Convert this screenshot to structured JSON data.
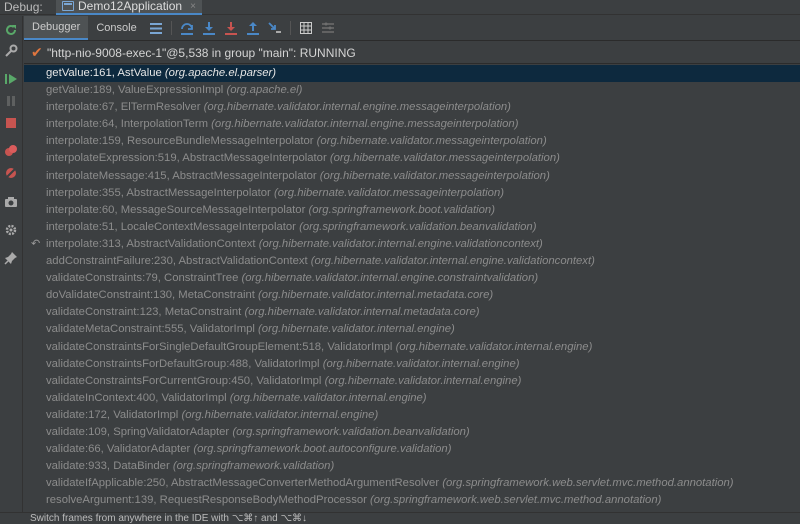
{
  "header": {
    "debug_label": "Debug:",
    "run_config": "Demo12Application",
    "close_glyph": "×"
  },
  "tabs": {
    "debugger": "Debugger",
    "console": "Console"
  },
  "toolbar_icons": [
    "list-icon",
    "step-over-icon",
    "step-into-icon",
    "force-step-into-icon",
    "step-out-icon",
    "run-to-cursor-icon",
    "evaluate-icon",
    "trace-icon"
  ],
  "left_toolbar_icons": [
    "rerun-icon",
    "settings-icon",
    "resume-icon",
    "pause-icon",
    "stop-icon",
    "view-breakpoints-icon",
    "mute-breakpoints-icon",
    "camera-icon",
    "gear-icon",
    "pin-icon"
  ],
  "thread": {
    "text": "\"http-nio-9008-exec-1\"@5,538 in group \"main\": RUNNING"
  },
  "frames": [
    {
      "method": "getValue:161, AstValue",
      "pkg": "(org.apache.el.parser)",
      "selected": true
    },
    {
      "method": "getValue:189, ValueExpressionImpl",
      "pkg": "(org.apache.el)"
    },
    {
      "method": "interpolate:67, ElTermResolver",
      "pkg": "(org.hibernate.validator.internal.engine.messageinterpolation)"
    },
    {
      "method": "interpolate:64, InterpolationTerm",
      "pkg": "(org.hibernate.validator.internal.engine.messageinterpolation)"
    },
    {
      "method": "interpolate:159, ResourceBundleMessageInterpolator",
      "pkg": "(org.hibernate.validator.messageinterpolation)"
    },
    {
      "method": "interpolateExpression:519, AbstractMessageInterpolator",
      "pkg": "(org.hibernate.validator.messageinterpolation)"
    },
    {
      "method": "interpolateMessage:415, AbstractMessageInterpolator",
      "pkg": "(org.hibernate.validator.messageinterpolation)"
    },
    {
      "method": "interpolate:355, AbstractMessageInterpolator",
      "pkg": "(org.hibernate.validator.messageinterpolation)"
    },
    {
      "method": "interpolate:60, MessageSourceMessageInterpolator",
      "pkg": "(org.springframework.boot.validation)"
    },
    {
      "method": "interpolate:51, LocaleContextMessageInterpolator",
      "pkg": "(org.springframework.validation.beanvalidation)"
    },
    {
      "method": "interpolate:313, AbstractValidationContext",
      "pkg": "(org.hibernate.validator.internal.engine.validationcontext)",
      "marker": "↶"
    },
    {
      "method": "addConstraintFailure:230, AbstractValidationContext",
      "pkg": "(org.hibernate.validator.internal.engine.validationcontext)"
    },
    {
      "method": "validateConstraints:79, ConstraintTree",
      "pkg": "(org.hibernate.validator.internal.engine.constraintvalidation)"
    },
    {
      "method": "doValidateConstraint:130, MetaConstraint",
      "pkg": "(org.hibernate.validator.internal.metadata.core)"
    },
    {
      "method": "validateConstraint:123, MetaConstraint",
      "pkg": "(org.hibernate.validator.internal.metadata.core)"
    },
    {
      "method": "validateMetaConstraint:555, ValidatorImpl",
      "pkg": "(org.hibernate.validator.internal.engine)"
    },
    {
      "method": "validateConstraintsForSingleDefaultGroupElement:518, ValidatorImpl",
      "pkg": "(org.hibernate.validator.internal.engine)"
    },
    {
      "method": "validateConstraintsForDefaultGroup:488, ValidatorImpl",
      "pkg": "(org.hibernate.validator.internal.engine)"
    },
    {
      "method": "validateConstraintsForCurrentGroup:450, ValidatorImpl",
      "pkg": "(org.hibernate.validator.internal.engine)"
    },
    {
      "method": "validateInContext:400, ValidatorImpl",
      "pkg": "(org.hibernate.validator.internal.engine)"
    },
    {
      "method": "validate:172, ValidatorImpl",
      "pkg": "(org.hibernate.validator.internal.engine)"
    },
    {
      "method": "validate:109, SpringValidatorAdapter",
      "pkg": "(org.springframework.validation.beanvalidation)"
    },
    {
      "method": "validate:66, ValidatorAdapter",
      "pkg": "(org.springframework.boot.autoconfigure.validation)"
    },
    {
      "method": "validate:933, DataBinder",
      "pkg": "(org.springframework.validation)"
    },
    {
      "method": "validateIfApplicable:250, AbstractMessageConverterMethodArgumentResolver",
      "pkg": "(org.springframework.web.servlet.mvc.method.annotation)"
    },
    {
      "method": "resolveArgument:139, RequestResponseBodyMethodProcessor",
      "pkg": "(org.springframework.web.servlet.mvc.method.annotation)"
    }
  ],
  "status": {
    "hint": "Switch frames from anywhere in the IDE with ⌥⌘↑ and ⌥⌘↓"
  },
  "colors": {
    "accent": "#4a88c7",
    "selection": "#0d293e",
    "running_check": "#e0763f"
  }
}
